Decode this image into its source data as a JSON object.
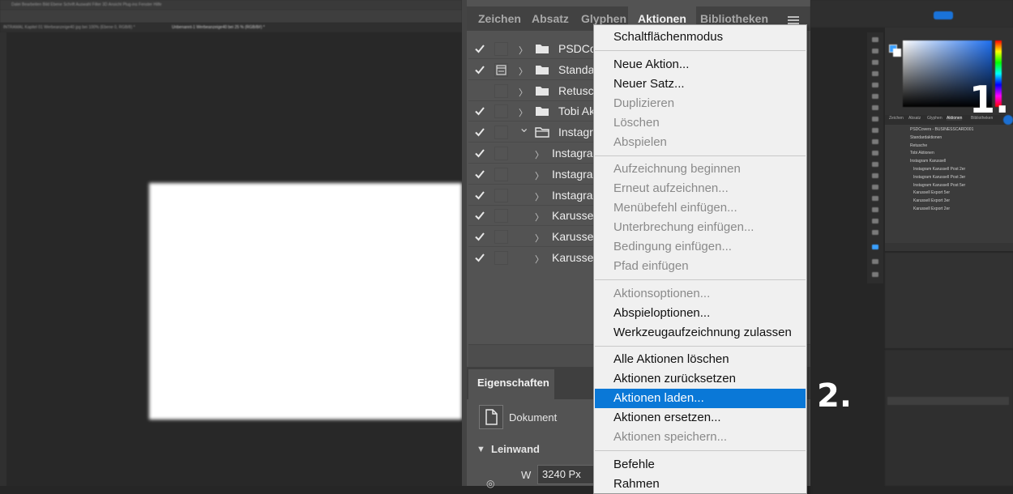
{
  "left_workspace": {
    "menubar_text": "Datei  Bearbeiten  Bild  Ebene  Schrift  Auswahl  Filter  3D  Ansicht  Plug-ins  Fenster  Hilfe",
    "doc_tab_1": "INTRAMAL Kapitel 01 Werbeanzeige40 jpg bei 100% (Ebene 0, RGB/8) *",
    "doc_tab_2": "Unbenannt-1 Werbeanzeige40 bei 25 % (RGB/8#) *"
  },
  "center": {
    "tabs": [
      "Zeichen",
      "Absatz",
      "Glyphen",
      "Aktionen",
      "Bibliotheken"
    ],
    "active_tab": "Aktionen",
    "action_rows": [
      {
        "label": "PSDCov",
        "checked": true,
        "dialog_icon": false,
        "expanded": false,
        "indent": 0,
        "folder": true
      },
      {
        "label": "Standar",
        "checked": true,
        "dialog_icon": true,
        "expanded": false,
        "indent": 0,
        "folder": true
      },
      {
        "label": "Retusch",
        "checked": false,
        "dialog_icon": false,
        "expanded": false,
        "indent": 0,
        "folder": true
      },
      {
        "label": "Tobi Ak",
        "checked": true,
        "dialog_icon": false,
        "expanded": false,
        "indent": 0,
        "folder": true
      },
      {
        "label": "Instagra",
        "checked": true,
        "dialog_icon": false,
        "expanded": true,
        "indent": 0,
        "folder": true
      },
      {
        "label": "Instagram",
        "checked": true,
        "dialog_icon": false,
        "expanded": false,
        "indent": 1,
        "folder": false
      },
      {
        "label": "Instagram",
        "checked": true,
        "dialog_icon": false,
        "expanded": false,
        "indent": 1,
        "folder": false
      },
      {
        "label": "Instagram",
        "checked": true,
        "dialog_icon": false,
        "expanded": false,
        "indent": 1,
        "folder": false
      },
      {
        "label": "Karussell",
        "checked": true,
        "dialog_icon": false,
        "expanded": false,
        "indent": 1,
        "folder": false
      },
      {
        "label": "Karussell",
        "checked": true,
        "dialog_icon": false,
        "expanded": false,
        "indent": 1,
        "folder": false
      },
      {
        "label": "Karussell",
        "checked": true,
        "dialog_icon": false,
        "expanded": false,
        "indent": 1,
        "folder": false
      }
    ],
    "properties": {
      "tab": "Eigenschaften",
      "doc_label": "Dokument",
      "section": "Leinwand",
      "w_label": "W",
      "w_value": "3240 Px"
    }
  },
  "context_menu": {
    "items": [
      {
        "label": "Schaltflächenmodus",
        "disabled": false,
        "highlighted": false
      },
      {
        "sep": true
      },
      {
        "label": "Neue Aktion...",
        "disabled": false,
        "highlighted": false
      },
      {
        "label": "Neuer Satz...",
        "disabled": false,
        "highlighted": false
      },
      {
        "label": "Duplizieren",
        "disabled": true,
        "highlighted": false
      },
      {
        "label": "Löschen",
        "disabled": true,
        "highlighted": false
      },
      {
        "label": "Abspielen",
        "disabled": true,
        "highlighted": false
      },
      {
        "sep": true
      },
      {
        "label": "Aufzeichnung beginnen",
        "disabled": true,
        "highlighted": false
      },
      {
        "label": "Erneut aufzeichnen...",
        "disabled": true,
        "highlighted": false
      },
      {
        "label": "Menübefehl einfügen...",
        "disabled": true,
        "highlighted": false
      },
      {
        "label": "Unterbrechung einfügen...",
        "disabled": true,
        "highlighted": false
      },
      {
        "label": "Bedingung einfügen...",
        "disabled": true,
        "highlighted": false
      },
      {
        "label": "Pfad einfügen",
        "disabled": true,
        "highlighted": false
      },
      {
        "sep": true
      },
      {
        "label": "Aktionsoptionen...",
        "disabled": true,
        "highlighted": false
      },
      {
        "label": "Abspieloptionen...",
        "disabled": false,
        "highlighted": false
      },
      {
        "label": "Werkzeugaufzeichnung zulassen",
        "disabled": false,
        "highlighted": false
      },
      {
        "sep": true
      },
      {
        "label": "Alle Aktionen löschen",
        "disabled": false,
        "highlighted": false
      },
      {
        "label": "Aktionen zurücksetzen",
        "disabled": false,
        "highlighted": false
      },
      {
        "label": "Aktionen laden...",
        "disabled": false,
        "highlighted": true
      },
      {
        "label": "Aktionen ersetzen...",
        "disabled": false,
        "highlighted": false
      },
      {
        "label": "Aktionen speichern...",
        "disabled": true,
        "highlighted": false
      },
      {
        "sep": true
      },
      {
        "label": "Befehle",
        "disabled": false,
        "highlighted": false
      },
      {
        "label": "Rahmen",
        "disabled": false,
        "highlighted": false
      }
    ]
  },
  "right_panels": {
    "mini_tabs": [
      "Zeichen",
      "Absatz",
      "Glyphen",
      "Aktionen",
      "Bibliotheken"
    ],
    "mini_rows": [
      "PSDCovers - BUSINESSCARD001",
      "Standardaktionen",
      "Retusche",
      "Tobi Aktionen",
      "Instagram Karussell",
      "Instagram Karussell Post 2er",
      "Instagram Karussell Post 3er",
      "Instagram Karussell Post 5er",
      "Karussell Export 5er",
      "Karussell Export 3er",
      "Karussell Export 2er"
    ]
  },
  "annotations": {
    "step1": "1.",
    "step2": "2."
  },
  "colors": {
    "highlight": "#0a78d7",
    "menu_bg": "#f0f0f0",
    "panel_bg": "#535353"
  }
}
